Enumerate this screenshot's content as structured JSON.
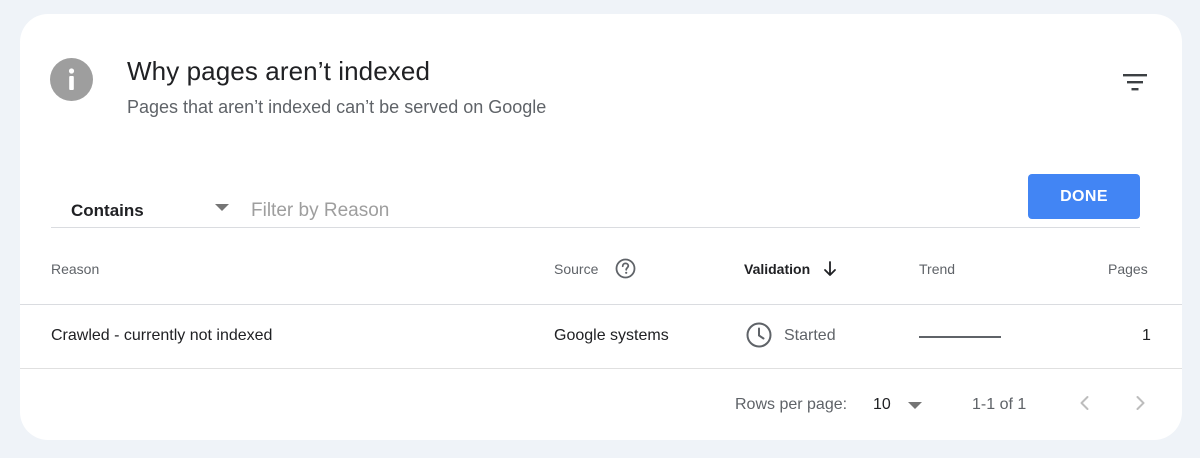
{
  "header": {
    "title": "Why pages aren’t indexed",
    "subtitle": "Pages that aren’t indexed can’t be served on Google"
  },
  "filter": {
    "operator": "Contains",
    "placeholder": "Filter by Reason",
    "done_label": "DONE"
  },
  "table": {
    "columns": {
      "reason": "Reason",
      "source": "Source",
      "validation": "Validation",
      "trend": "Trend",
      "pages": "Pages"
    },
    "rows": [
      {
        "reason": "Crawled - currently not indexed",
        "source": "Google systems",
        "validation": "Started",
        "pages": "1"
      }
    ]
  },
  "pagination": {
    "rows_per_page_label": "Rows per page:",
    "rows_per_page_value": "10",
    "range": "1-1 of 1"
  },
  "colors": {
    "accent": "#4285f4",
    "card_background": "#ffffff",
    "page_background": "#eff3f8",
    "info_icon": "#9e9e9e"
  },
  "icons": [
    "info-icon",
    "filter-list-icon",
    "dropdown-arrow-icon",
    "help-circle-icon",
    "arrow-down-icon",
    "clock-icon",
    "chevron-left-icon",
    "chevron-right-icon"
  ]
}
